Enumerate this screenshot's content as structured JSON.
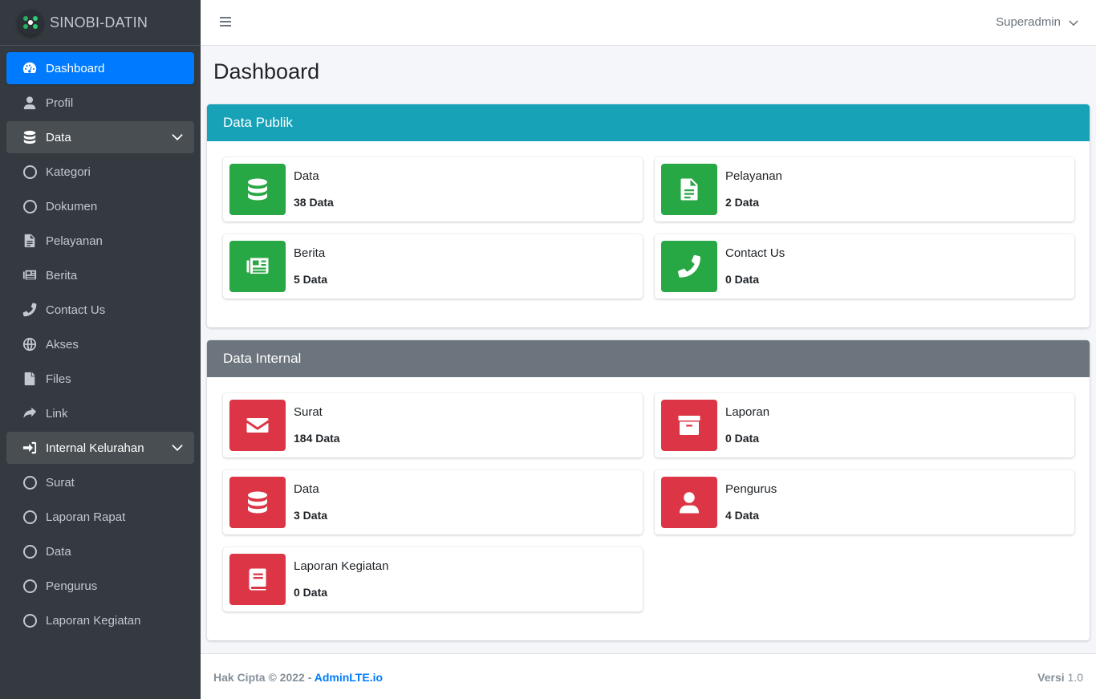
{
  "brand": {
    "name": "SINOBI-DATIN"
  },
  "header": {
    "user": "Superadmin"
  },
  "sidebar": {
    "items": [
      {
        "label": "Dashboard",
        "icon": "tachometer-icon",
        "state": "active"
      },
      {
        "label": "Profil",
        "icon": "user-icon"
      },
      {
        "label": "Data",
        "icon": "database-icon",
        "state": "open",
        "expandable": true
      },
      {
        "label": "Kategori",
        "icon": "circle-icon"
      },
      {
        "label": "Dokumen",
        "icon": "circle-icon"
      },
      {
        "label": "Pelayanan",
        "icon": "file-alt-icon"
      },
      {
        "label": "Berita",
        "icon": "newspaper-icon"
      },
      {
        "label": "Contact Us",
        "icon": "phone-icon"
      },
      {
        "label": "Akses",
        "icon": "globe-icon"
      },
      {
        "label": "Files",
        "icon": "file-icon"
      },
      {
        "label": "Link",
        "icon": "share-icon"
      },
      {
        "label": "Internal Kelurahan",
        "icon": "sign-in-icon",
        "state": "open",
        "expandable": true
      },
      {
        "label": "Surat",
        "icon": "circle-icon"
      },
      {
        "label": "Laporan Rapat",
        "icon": "circle-icon"
      },
      {
        "label": "Data",
        "icon": "circle-icon"
      },
      {
        "label": "Pengurus",
        "icon": "circle-icon"
      },
      {
        "label": "Laporan Kegiatan",
        "icon": "circle-icon"
      }
    ]
  },
  "main": {
    "title": "Dashboard",
    "public": {
      "title": "Data Publik",
      "color": "#17a2b8",
      "boxes": [
        {
          "label": "Data",
          "value": "38 Data",
          "icon": "database-icon",
          "color": "#28a745"
        },
        {
          "label": "Pelayanan",
          "value": "2 Data",
          "icon": "file-alt-icon",
          "color": "#28a745"
        },
        {
          "label": "Berita",
          "value": "5 Data",
          "icon": "newspaper-icon",
          "color": "#28a745"
        },
        {
          "label": "Contact Us",
          "value": "0 Data",
          "icon": "phone-icon",
          "color": "#28a745"
        }
      ]
    },
    "internal": {
      "title": "Data Internal",
      "color": "#6c757d",
      "boxes": [
        {
          "label": "Surat",
          "value": "184 Data",
          "icon": "envelope-icon",
          "color": "#dc3545"
        },
        {
          "label": "Laporan",
          "value": "0 Data",
          "icon": "archive-icon",
          "color": "#dc3545"
        },
        {
          "label": "Data",
          "value": "3 Data",
          "icon": "database-icon",
          "color": "#dc3545"
        },
        {
          "label": "Pengurus",
          "value": "4 Data",
          "icon": "user-icon",
          "color": "#dc3545"
        },
        {
          "label": "Laporan Kegiatan",
          "value": "0 Data",
          "icon": "book-icon",
          "color": "#dc3545"
        }
      ]
    }
  },
  "footer": {
    "copyright": "Hak Cipta © 2022 - ",
    "link": "AdminLTE.io",
    "version_label": "Versi",
    "version": "1.0"
  }
}
